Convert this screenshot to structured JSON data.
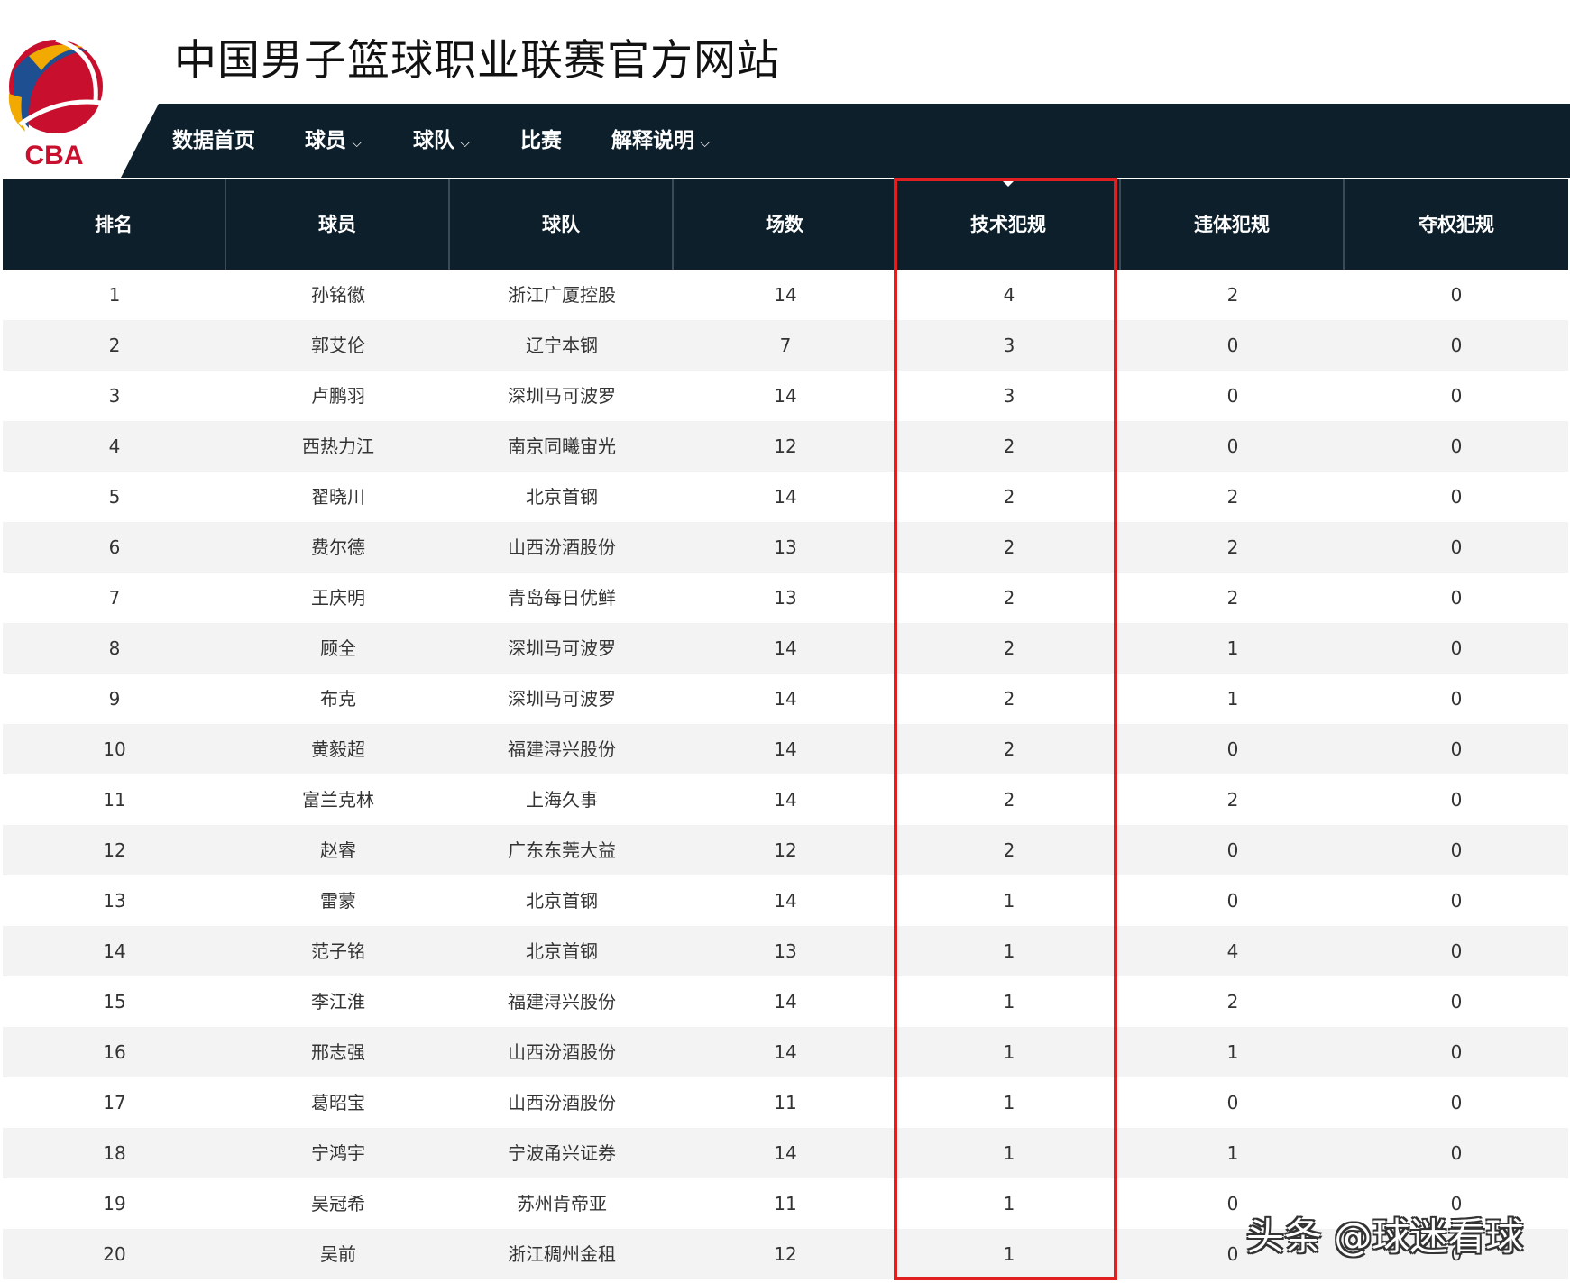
{
  "header": {
    "site_title": "中国男子篮球职业联赛官方网站",
    "logo_text": "CBA",
    "logo_icon": "cba-basketball-logo"
  },
  "nav": {
    "items": [
      {
        "label": "数据首页",
        "dropdown": false
      },
      {
        "label": "球员",
        "dropdown": true
      },
      {
        "label": "球队",
        "dropdown": true
      },
      {
        "label": "比赛",
        "dropdown": false
      },
      {
        "label": "解释说明",
        "dropdown": true
      }
    ],
    "chevron": "⌵"
  },
  "table": {
    "headers": [
      "排名",
      "球员",
      "球队",
      "场数",
      "技术犯规",
      "违体犯规",
      "夺权犯规"
    ],
    "sorted_column": "技术犯规",
    "rows": [
      [
        "1",
        "孙铭徽",
        "浙江广厦控股",
        "14",
        "4",
        "2",
        "0"
      ],
      [
        "2",
        "郭艾伦",
        "辽宁本钢",
        "7",
        "3",
        "0",
        "0"
      ],
      [
        "3",
        "卢鹏羽",
        "深圳马可波罗",
        "14",
        "3",
        "0",
        "0"
      ],
      [
        "4",
        "西热力江",
        "南京同曦宙光",
        "12",
        "2",
        "0",
        "0"
      ],
      [
        "5",
        "翟晓川",
        "北京首钢",
        "14",
        "2",
        "2",
        "0"
      ],
      [
        "6",
        "费尔德",
        "山西汾酒股份",
        "13",
        "2",
        "2",
        "0"
      ],
      [
        "7",
        "王庆明",
        "青岛每日优鲜",
        "13",
        "2",
        "2",
        "0"
      ],
      [
        "8",
        "顾全",
        "深圳马可波罗",
        "14",
        "2",
        "1",
        "0"
      ],
      [
        "9",
        "布克",
        "深圳马可波罗",
        "14",
        "2",
        "1",
        "0"
      ],
      [
        "10",
        "黄毅超",
        "福建浔兴股份",
        "14",
        "2",
        "0",
        "0"
      ],
      [
        "11",
        "富兰克林",
        "上海久事",
        "14",
        "2",
        "2",
        "0"
      ],
      [
        "12",
        "赵睿",
        "广东东莞大益",
        "12",
        "2",
        "0",
        "0"
      ],
      [
        "13",
        "雷蒙",
        "北京首钢",
        "14",
        "1",
        "0",
        "0"
      ],
      [
        "14",
        "范子铭",
        "北京首钢",
        "13",
        "1",
        "4",
        "0"
      ],
      [
        "15",
        "李江淮",
        "福建浔兴股份",
        "14",
        "1",
        "2",
        "0"
      ],
      [
        "16",
        "邢志强",
        "山西汾酒股份",
        "14",
        "1",
        "1",
        "0"
      ],
      [
        "17",
        "葛昭宝",
        "山西汾酒股份",
        "11",
        "1",
        "0",
        "0"
      ],
      [
        "18",
        "宁鸿宇",
        "宁波甬兴证券",
        "14",
        "1",
        "1",
        "0"
      ],
      [
        "19",
        "吴冠希",
        "苏州肯帝亚",
        "11",
        "1",
        "0",
        "0"
      ],
      [
        "20",
        "吴前",
        "浙江稠州金租",
        "12",
        "1",
        "0",
        "0"
      ]
    ]
  },
  "highlight_color": "#e02020",
  "watermark": "头条 @球迷看球"
}
